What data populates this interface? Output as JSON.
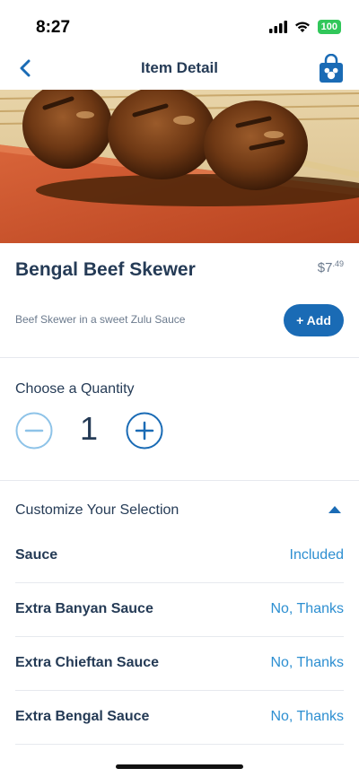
{
  "status_bar": {
    "time": "8:27",
    "battery": "100"
  },
  "nav": {
    "title": "Item Detail",
    "back_icon": "chevron-left-icon",
    "bag_icon": "mickey-shopping-bag-icon"
  },
  "item": {
    "name": "Bengal Beef Skewer",
    "price_dollars": "$7",
    "price_cents": ".49",
    "description": "Beef Skewer in a sweet Zulu Sauce",
    "add_label": "+ Add"
  },
  "quantity": {
    "label": "Choose a Quantity",
    "value": "1"
  },
  "customize": {
    "title": "Customize Your Selection",
    "options": [
      {
        "label": "Sauce",
        "value": "Included"
      },
      {
        "label": "Extra Banyan Sauce",
        "value": "No, Thanks"
      },
      {
        "label": "Extra Chieftan Sauce",
        "value": "No, Thanks"
      },
      {
        "label": "Extra Bengal Sauce",
        "value": "No, Thanks"
      }
    ]
  },
  "colors": {
    "accent": "#1a6bb5",
    "link": "#2d8fd1",
    "text": "#253b56"
  }
}
